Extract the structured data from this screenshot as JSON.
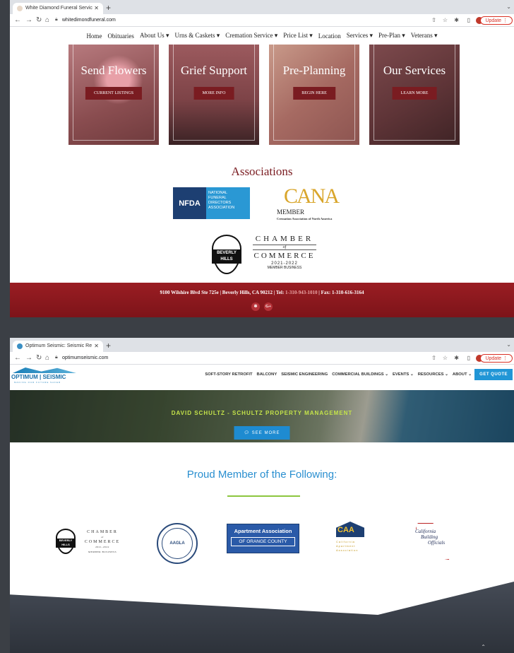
{
  "shot1": {
    "browser": {
      "tab_title": "White Diamond Funeral Servic",
      "url": "whitedimondfuneral.com",
      "update_label": "Update"
    },
    "nav": [
      "Home",
      "Obituaries",
      "About Us ▾",
      "Urns & Caskets ▾",
      "Cremation Service ▾",
      "Price List ▾",
      "Location",
      "Services ▾",
      "Pre-Plan ▾",
      "Veterans ▾"
    ],
    "cards": [
      {
        "title": "Send Flowers",
        "button": "CURRENT LISTINGS"
      },
      {
        "title": "Grief Support",
        "button": "MORE INFO"
      },
      {
        "title": "Pre-Planning",
        "button": "BEGIN HERE"
      },
      {
        "title": "Our Services",
        "button": "LEARN MORE"
      }
    ],
    "associations_title": "Associations",
    "nfda": {
      "abbr": "NFDA",
      "lines": [
        "NATIONAL",
        "FUNERAL",
        "DIRECTORS",
        "ASSOCIATION"
      ]
    },
    "cana": {
      "mark": "CANA",
      "member": "MEMBER",
      "sub": "Cremation Association of North America"
    },
    "chamber": {
      "seal_top": "BEVERLY",
      "seal_bottom": "HILLS",
      "line1": "CHAMBER",
      "of": "of",
      "line2": "COMMERCE",
      "years": "2021-2022",
      "member": "MEMBER BUSINESS"
    },
    "footer": {
      "address": "9100 Wilshire Blvd Ste 725e | Beverly Hills, CA 90212 | Tel: ",
      "tel": "1-310-943-1010",
      "fax": " | Fax: 1-310-616-3164",
      "social": [
        "yelp",
        "G+"
      ]
    },
    "colors": {
      "brand": "#7a1c21",
      "footer": "#9a1d23"
    }
  },
  "shot2": {
    "browser": {
      "tab_title": "Optimum Seismic: Seismic Re",
      "url": "optimumseismic.com",
      "update_label": "Update"
    },
    "logo": {
      "name": "OPTIMUM | SEISMIC",
      "tagline": "MAKING OUR FUTURE SAFER"
    },
    "nav": [
      "SOFT-STORY RETROFIT",
      "BALCONY",
      "SEISMIC ENGINEERING",
      "COMMERCIAL BUILDINGS ⌄",
      "EVENTS ⌄",
      "RESOURCES ⌄",
      "ABOUT ⌄"
    ],
    "quote_button": "GET QUOTE",
    "hero": {
      "title": "DAVID SCHULTZ - SCHULTZ PROPERTY MANAGEMENT",
      "button": "SEE MORE"
    },
    "section_title": "Proud Member of the Following:",
    "logos": {
      "chamber": {
        "seal_top": "BEVERLY",
        "seal_bottom": "HILLS",
        "line1": "CHAMBER",
        "of": "of",
        "line2": "COMMERCE",
        "years": "2021-2022",
        "member": "MEMBER BUSINESS"
      },
      "aagla": "AAGLA",
      "aaoc": {
        "line1": "Apartment Association",
        "line2": "OF  ORANGE COUNTY"
      },
      "caa": {
        "mark": "CAA",
        "lines": [
          "California",
          "Apartment",
          "Association"
        ]
      },
      "cbo": [
        "California",
        "Building",
        "Officials"
      ]
    },
    "colors": {
      "accent": "#2196d6",
      "green": "#8cc63f"
    }
  }
}
